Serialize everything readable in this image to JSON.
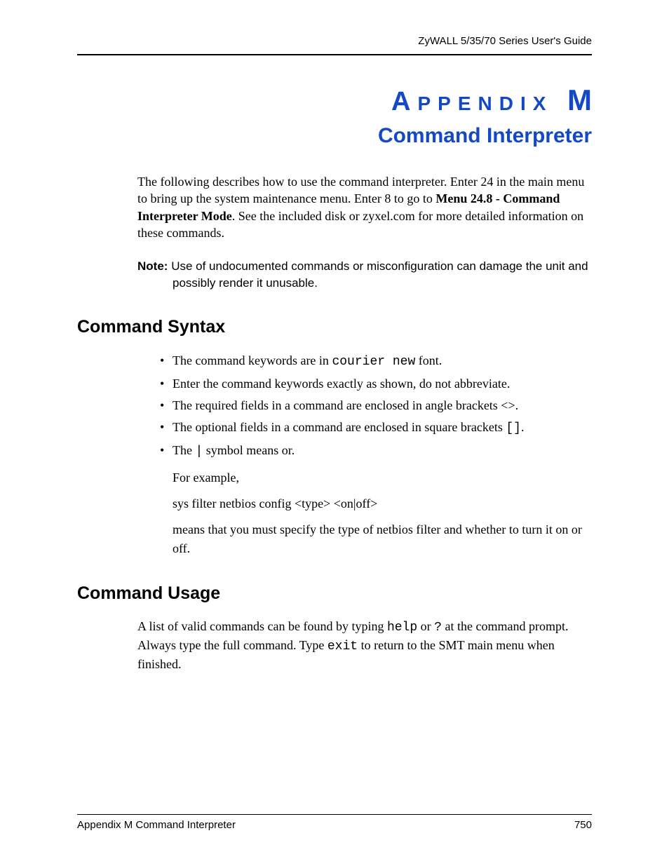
{
  "header": {
    "guide": "ZyWALL 5/35/70 Series User's Guide"
  },
  "title": {
    "appendix_word_first": "A",
    "appendix_word_rest": "PPENDIX",
    "appendix_letter": "M",
    "subtitle": "Command Interpreter"
  },
  "intro": {
    "text_before_bold": "The following describes how to use the command interpreter. Enter 24 in the main menu to bring up the system maintenance menu. Enter 8 to go to ",
    "bold": "Menu 24.8 - Command Interpreter Mode",
    "text_after_bold": ". See the included disk or zyxel.com for more detailed information on these commands."
  },
  "note": {
    "label": "Note:",
    "line1": "Use of undocumented commands or misconfiguration can damage the unit and",
    "line2": "possibly render it unusable."
  },
  "section_syntax": {
    "heading": "Command Syntax",
    "items": {
      "i0_a": "The command keywords are in ",
      "i0_mono": "courier new",
      "i0_b": " font.",
      "i1": "Enter the command keywords exactly as shown, do not abbreviate.",
      "i2": "The required fields in a command are enclosed in angle brackets <>.",
      "i3_a": "The optional fields in a command are enclosed in square brackets ",
      "i3_mono": "[]",
      "i3_b": ".",
      "i4_a": "The ",
      "i4_mono": "|",
      "i4_b": " symbol means or.",
      "i4_sub1": "For example,",
      "i4_sub2": "sys filter netbios config <type> <on|off>",
      "i4_sub3": "means that you must specify the type of netbios filter and whether to turn it on or off."
    }
  },
  "section_usage": {
    "heading": "Command Usage",
    "p_a": "A list of valid commands can be found by typing ",
    "p_mono1": "help",
    "p_b": " or ",
    "p_mono2": "?",
    "p_c": " at the command prompt. Always type the full command. Type ",
    "p_mono3": "exit",
    "p_d": " to return to the SMT main menu when finished."
  },
  "footer": {
    "left": "Appendix M Command Interpreter",
    "right": "750"
  }
}
